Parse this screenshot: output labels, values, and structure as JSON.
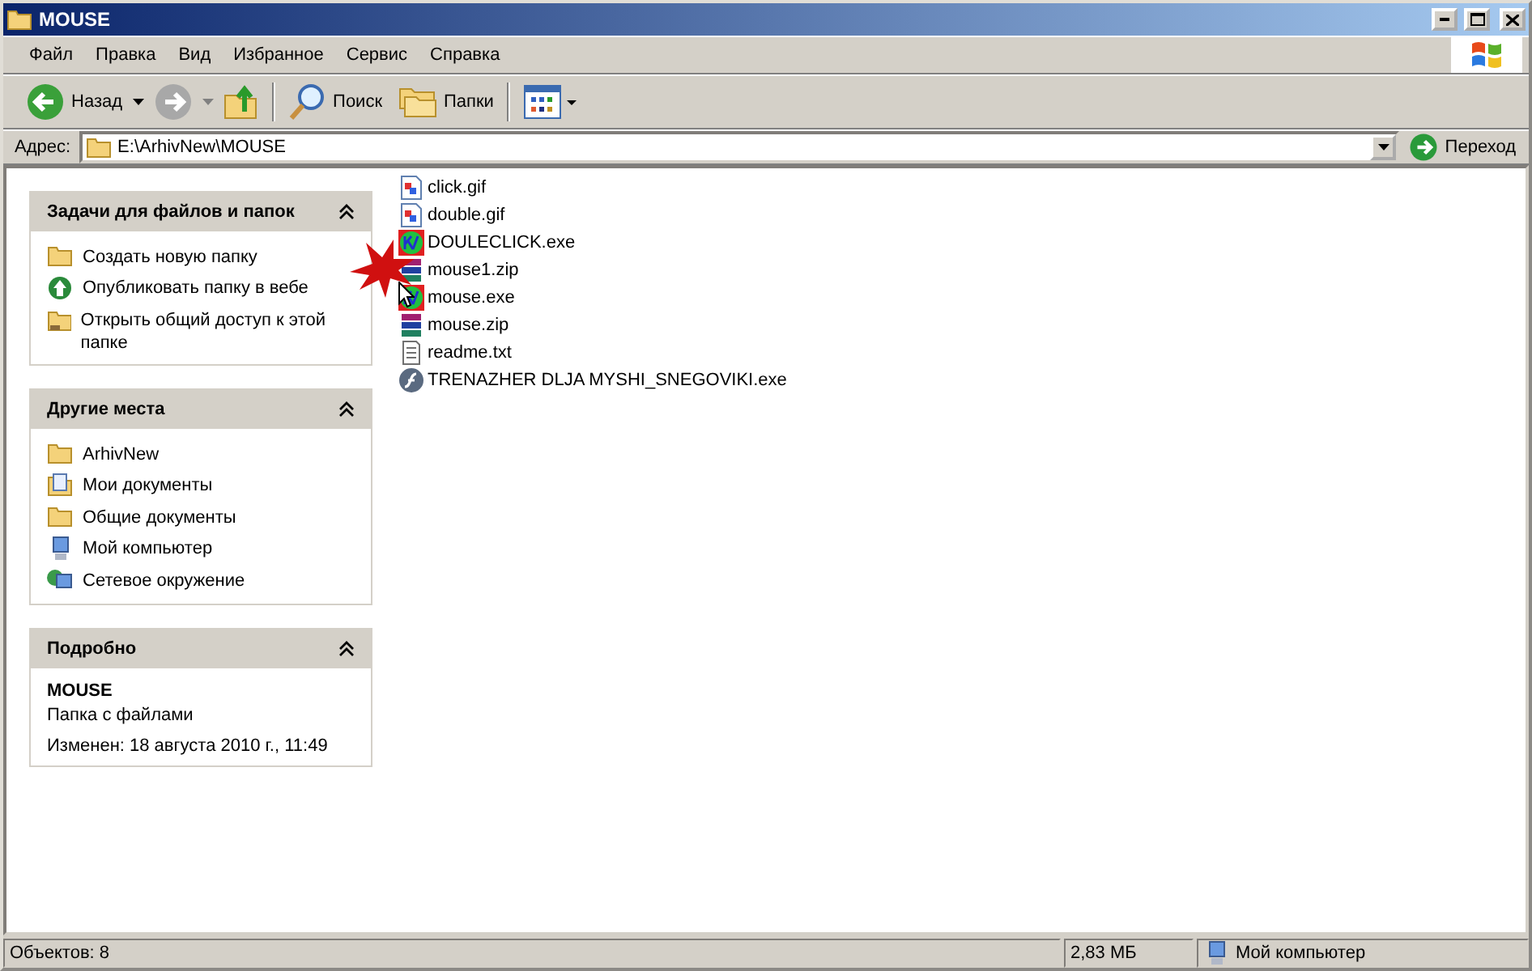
{
  "window": {
    "title": "MOUSE"
  },
  "menu": [
    "Файл",
    "Правка",
    "Вид",
    "Избранное",
    "Сервис",
    "Справка"
  ],
  "toolbar": {
    "back": "Назад",
    "search": "Поиск",
    "folders": "Папки"
  },
  "address": {
    "label": "Адрес:",
    "value": "E:\\ArhivNew\\MOUSE",
    "go": "Переход"
  },
  "panels": [
    {
      "kind": "links",
      "title": "Задачи для файлов и папок",
      "expanded": true,
      "items": [
        {
          "kind": "new-folder",
          "label": "Создать новую папку"
        },
        {
          "kind": "publish",
          "label": "Опубликовать папку в вебе"
        },
        {
          "kind": "share",
          "label": "Открыть общий доступ к этой папке"
        }
      ]
    },
    {
      "kind": "links",
      "title": "Другие места",
      "expanded": true,
      "items": [
        {
          "kind": "folder",
          "label": "ArhivNew"
        },
        {
          "kind": "documents",
          "label": "Мои документы"
        },
        {
          "kind": "folder",
          "label": "Общие документы"
        },
        {
          "kind": "computer",
          "label": "Мой компьютер"
        },
        {
          "kind": "network",
          "label": "Сетевое окружение"
        }
      ]
    },
    {
      "kind": "details",
      "title": "Подробно",
      "expanded": true,
      "name": "MOUSE",
      "type": "Папка с файлами",
      "modified": "Изменен: 18 августа 2010 г., 11:49"
    }
  ],
  "files": [
    {
      "kind": "image",
      "name": "click.gif"
    },
    {
      "kind": "image",
      "name": "double.gif"
    },
    {
      "kind": "program",
      "name": "DOULECLICK.exe"
    },
    {
      "kind": "archive",
      "name": "mouse1.zip"
    },
    {
      "kind": "program",
      "name": "mouse.exe"
    },
    {
      "kind": "archive",
      "name": "mouse.zip"
    },
    {
      "kind": "text",
      "name": "readme.txt"
    },
    {
      "kind": "flash",
      "name": "TRENAZHER DLJA MYSHI_SNEGOVIKI.exe"
    }
  ],
  "status_bar": {
    "objects": "Объектов: 8",
    "size": "2,83 МБ",
    "zone": "Мой компьютер"
  }
}
